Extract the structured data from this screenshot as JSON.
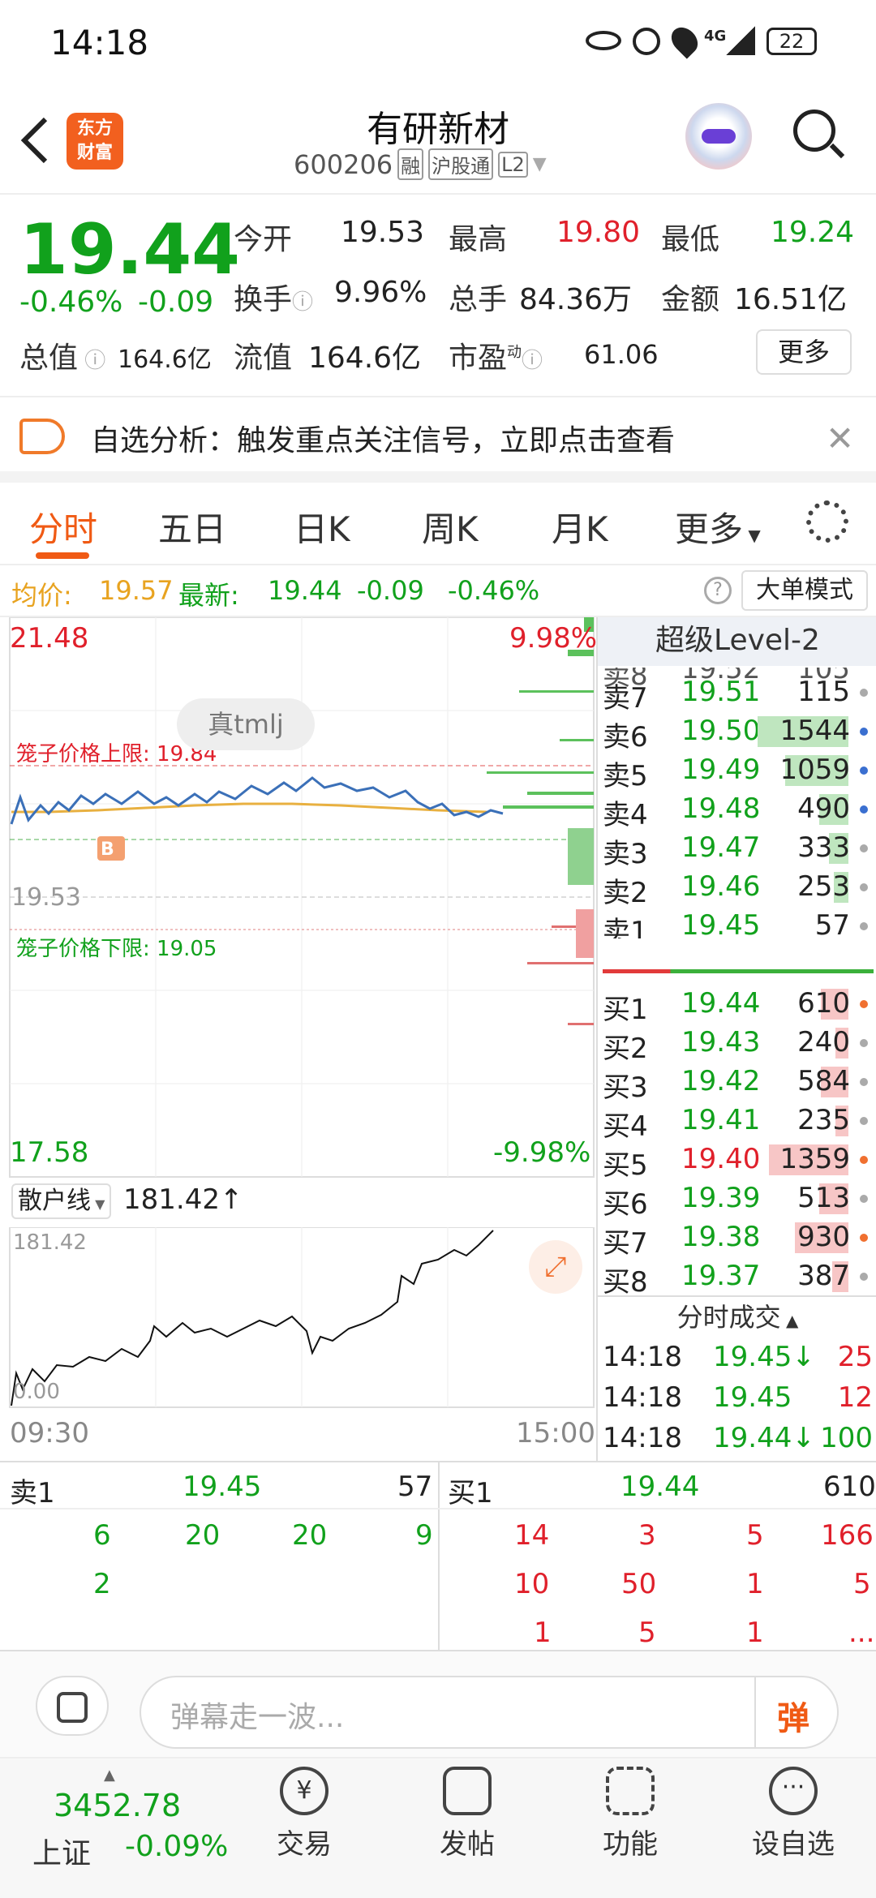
{
  "status": {
    "time": "14:18",
    "signal": "4G",
    "battery": "22"
  },
  "nav": {
    "brand": "东方\n财富",
    "name": "有研新材",
    "code": "600206",
    "tags": [
      "融",
      "沪股通",
      "L2"
    ]
  },
  "quote": {
    "price": "19.44",
    "pct": "-0.46%",
    "chg": "-0.09",
    "open_l": "今开",
    "open": "19.53",
    "high_l": "最高",
    "high": "19.80",
    "low_l": "最低",
    "low": "19.24",
    "turn_l": "换手",
    "turn": "9.96%",
    "vol_l": "总手",
    "vol": "84.36万",
    "amt_l": "金额",
    "amt": "16.51亿",
    "cap_l": "总值",
    "cap": "164.6亿",
    "float_l": "流值",
    "float": "164.6亿",
    "pe_l": "市盈",
    "pe_sup": "动",
    "pe": "61.06",
    "more": "更多"
  },
  "notice": {
    "text": "自选分析：触发重点关注信号，立即点击查看"
  },
  "tabs": [
    "分时",
    "五日",
    "日K",
    "周K",
    "月K",
    "更多"
  ],
  "info": {
    "avg_l": "均价:",
    "avg": "19.57",
    "last_l": "最新:",
    "last": "19.44",
    "chg": "-0.09",
    "pct": "-0.46%",
    "mode": "大单模式"
  },
  "chart": {
    "ymax": "21.48",
    "ymin": "17.58",
    "pmax": "9.98%",
    "pmin": "-9.98%",
    "ref": "19.53",
    "upper": "笼子价格上限: 19.84",
    "lower": "笼子价格下限: 19.05",
    "watermark": "真tmlj",
    "marker": "B",
    "t0": "09:30",
    "t1": "15:00",
    "sub_sel": "散户线",
    "sub_val": "181.42↑",
    "sub_max": "181.42",
    "sub_min": "0.00"
  },
  "level2": {
    "title": "超级Level-2",
    "sells": [
      [
        "卖7",
        "19.51",
        "115"
      ],
      [
        "卖6",
        "19.50",
        "1544"
      ],
      [
        "卖5",
        "19.49",
        "1059"
      ],
      [
        "卖4",
        "19.48",
        "490"
      ],
      [
        "卖3",
        "19.47",
        "333"
      ],
      [
        "卖2",
        "19.46",
        "253"
      ],
      [
        "卖1",
        "19.45",
        "57"
      ]
    ],
    "buys": [
      [
        "买1",
        "19.44",
        "610"
      ],
      [
        "买2",
        "19.43",
        "240"
      ],
      [
        "买3",
        "19.42",
        "584"
      ],
      [
        "买4",
        "19.41",
        "235"
      ],
      [
        "买5",
        "19.40",
        "1359"
      ],
      [
        "买6",
        "19.39",
        "513"
      ],
      [
        "买7",
        "19.38",
        "930"
      ],
      [
        "买8",
        "19.37",
        "387"
      ]
    ],
    "ticks_title": "分时成交",
    "ticks": [
      [
        "14:18",
        "19.45↓",
        "25"
      ],
      [
        "14:18",
        "19.45",
        "12"
      ],
      [
        "14:18",
        "19.44↓",
        "100"
      ]
    ]
  },
  "queue": {
    "sell_l": "卖1",
    "sell_p": "19.45",
    "sell_v": "57",
    "buy_l": "买1",
    "buy_p": "19.44",
    "buy_v": "610",
    "sell_rows": [
      [
        "6",
        "20",
        "20",
        "9"
      ],
      [
        "2",
        "",
        "",
        ""
      ]
    ],
    "buy_rows": [
      [
        "14",
        "3",
        "5",
        "166"
      ],
      [
        "10",
        "50",
        "1",
        "5"
      ],
      [
        "1",
        "5",
        "1",
        "..."
      ]
    ]
  },
  "comment": {
    "placeholder": "弹幕走一波...",
    "btn": "弹"
  },
  "bottom": {
    "index_val": "3452.78",
    "index_name": "上证",
    "index_pct": "-0.09%",
    "items": [
      "交易",
      "发帖",
      "功能",
      "设自选"
    ]
  }
}
